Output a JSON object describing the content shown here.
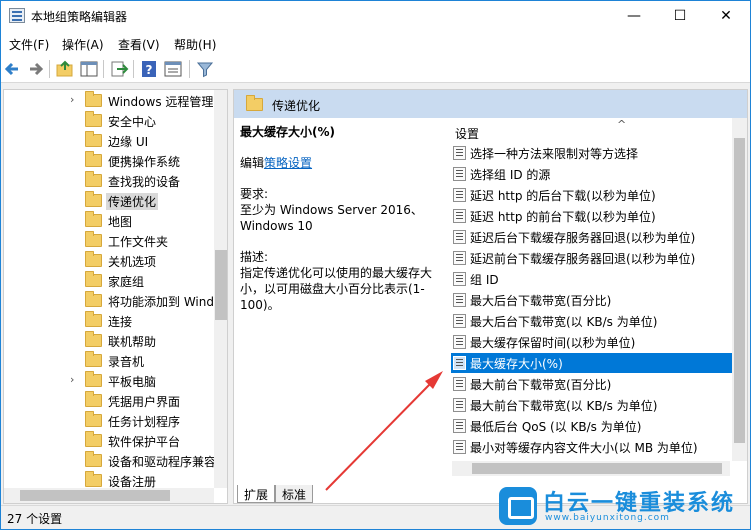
{
  "window": {
    "title": "本地组策略编辑器",
    "minimize": "—",
    "maximize": "☐",
    "close": "✕"
  },
  "menu": [
    "文件(F)",
    "操作(A)",
    "查看(V)",
    "帮助(H)"
  ],
  "toolbar_icons": [
    "back-arrow-icon",
    "forward-arrow-icon",
    "up-folder-icon",
    "show-hide-tree-icon",
    "export-list-icon",
    "help-icon",
    "properties-icon",
    "filter-icon"
  ],
  "tree": {
    "items": [
      {
        "label": "Windows 远程管理",
        "expandable": true
      },
      {
        "label": "安全中心",
        "expandable": false
      },
      {
        "label": "边缘 UI",
        "expandable": false
      },
      {
        "label": "便携操作系统",
        "expandable": false
      },
      {
        "label": "查找我的设备",
        "expandable": false
      },
      {
        "label": "传递优化",
        "expandable": false,
        "selected": true
      },
      {
        "label": "地图",
        "expandable": false
      },
      {
        "label": "工作文件夹",
        "expandable": false
      },
      {
        "label": "关机选项",
        "expandable": false
      },
      {
        "label": "家庭组",
        "expandable": false
      },
      {
        "label": "将功能添加到 Wind",
        "expandable": false
      },
      {
        "label": "连接",
        "expandable": false
      },
      {
        "label": "联机帮助",
        "expandable": false
      },
      {
        "label": "录音机",
        "expandable": false
      },
      {
        "label": "平板电脑",
        "expandable": true
      },
      {
        "label": "凭据用户界面",
        "expandable": false
      },
      {
        "label": "任务计划程序",
        "expandable": false
      },
      {
        "label": "软件保护平台",
        "expandable": false
      },
      {
        "label": "设备和驱动程序兼容",
        "expandable": false
      },
      {
        "label": "设备注册",
        "expandable": false
      }
    ]
  },
  "detail": {
    "header": "传递优化",
    "title": "最大缓存大小(%)",
    "edit_prefix": "编辑",
    "edit_link": "策略设置",
    "req_label": "要求:",
    "req_text": "至少为 Windows Server 2016、Windows 10",
    "desc_label": "描述:",
    "desc_text": "指定传递优化可以使用的最大缓存大小，以可用磁盘大小百分比表示(1-100)。"
  },
  "list": {
    "column": "设置",
    "scroll_up": "^",
    "items": [
      "选择一种方法来限制对等方选择",
      "选择组 ID 的源",
      "延迟 http 的后台下载(以秒为单位)",
      "延迟 http 的前台下载(以秒为单位)",
      "延迟后台下载缓存服务器回退(以秒为单位)",
      "延迟前台下载缓存服务器回退(以秒为单位)",
      "组 ID",
      "最大后台下载带宽(百分比)",
      "最大后台下载带宽(以 KB/s 为单位)",
      "最大缓存保留时间(以秒为单位)",
      "最大缓存大小(%)",
      "最大前台下载带宽(百分比)",
      "最大前台下载带宽(以 KB/s 为单位)",
      "最低后台 QoS (以 KB/s 为单位)",
      "最小对等缓存内容文件大小(以 MB 为单位)"
    ],
    "selected_index": 10
  },
  "tabs": [
    "扩展",
    "标准"
  ],
  "status": "27 个设置",
  "watermark": {
    "title": "白云一键重装系统",
    "url": "www.baiyunxitong.com"
  },
  "colors": {
    "selection": "#0078d7",
    "header": "#c9dbf0",
    "annotation_arrow": "#e53935",
    "brand": "#1a8ddb"
  }
}
